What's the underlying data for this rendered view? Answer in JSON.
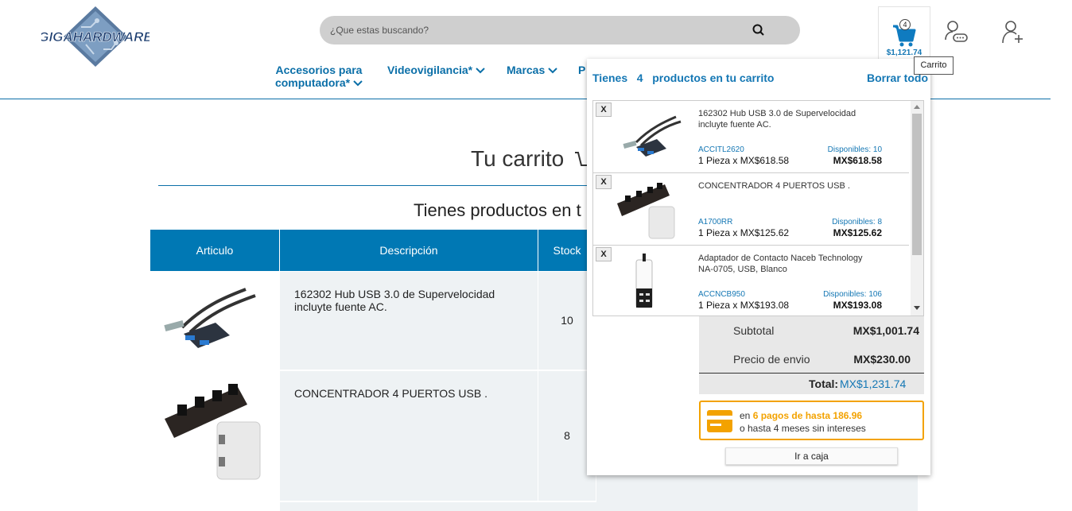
{
  "header": {
    "logo_text": "GIGAHARDWARE",
    "search_placeholder": "¿Que estas buscando?",
    "cart_count": "4",
    "cart_total": "$1,121.74",
    "cart_tooltip": "Carrito"
  },
  "nav": {
    "items": [
      {
        "line1": "Accesorios para",
        "line2": "computadora*"
      },
      {
        "label": "Videovigilancia*"
      },
      {
        "label": "Marcas"
      },
      {
        "label": "P"
      }
    ]
  },
  "main": {
    "title": "Tu carrito",
    "subtitle": "Tienes productos en t",
    "columns": [
      "Articulo",
      "Descripción",
      "Stock"
    ],
    "rows": [
      {
        "description": "162302 Hub USB 3.0 de Supervelocidad incluyte fuente AC.",
        "stock": "10"
      },
      {
        "description": "CONCENTRADOR 4 PUERTOS USB .",
        "stock": "8"
      }
    ]
  },
  "dropdown": {
    "header_prefix": "Tienes",
    "header_count": "4",
    "header_suffix": "productos en tu carrito",
    "clear_label": "Borrar todo",
    "remove_label": "X",
    "items": [
      {
        "name": "162302 Hub USB 3.0 de Supervelocidad incluyte fuente AC.",
        "sku": "ACCITL2620",
        "available": "Disponibles: 10",
        "qty": "1 Pieza x MX$618.58",
        "subtotal": "MX$618.58"
      },
      {
        "name": "CONCENTRADOR 4 PUERTOS USB .",
        "sku": "A1700RR",
        "available": "Disponibles: 8",
        "qty": "1 Pieza x MX$125.62",
        "subtotal": "MX$125.62"
      },
      {
        "name": "Adaptador de Contacto Naceb Technology NA-0705, USB, Blanco",
        "sku": "ACCNCB950",
        "available": "Disponibles: 106",
        "qty": "1 Pieza x MX$193.08",
        "subtotal": "MX$193.08"
      }
    ],
    "subtotal_label": "Subtotal",
    "subtotal_value": "MX$1,001.74",
    "shipping_label": "Precio de envio",
    "shipping_value": "MX$230.00",
    "total_label": "Total:",
    "total_value": "MX$1,231.74",
    "promo_prefix": "en",
    "promo_highlight": "6 pagos de hasta 186.96",
    "promo_line2": "o hasta 4 meses sin intereses",
    "checkout_label": "Ir a caja"
  },
  "colors": {
    "brand_blue": "#0078b4",
    "link_blue": "#1477b4",
    "promo_orange": "#f3a200"
  }
}
